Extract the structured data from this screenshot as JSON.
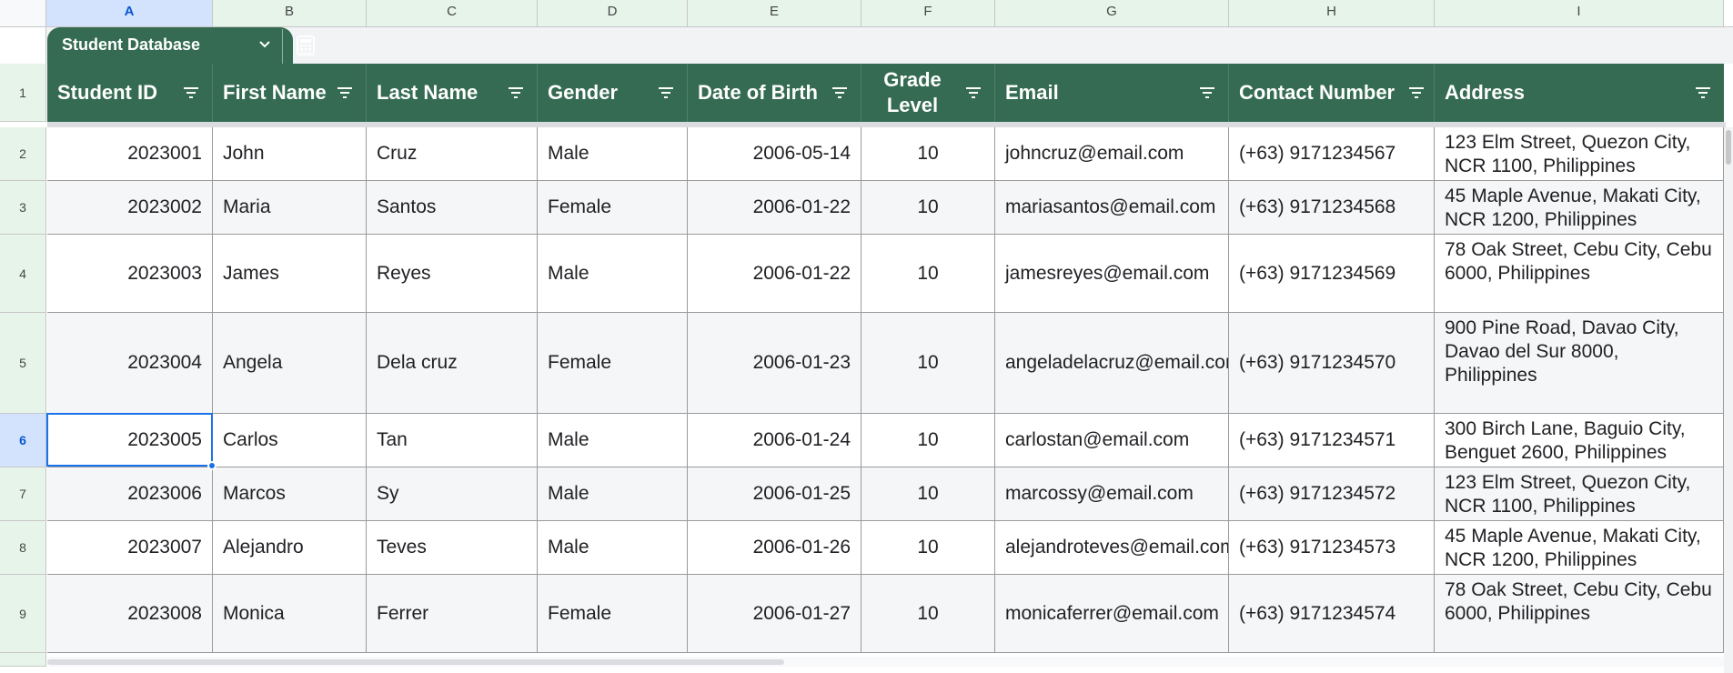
{
  "sheet": {
    "columns": [
      "A",
      "B",
      "C",
      "D",
      "E",
      "F",
      "G",
      "H",
      "I"
    ],
    "selected_column": "A",
    "selected_row": "6",
    "row_numbers": [
      "1",
      "2",
      "3",
      "4",
      "5",
      "6",
      "7",
      "8",
      "9"
    ]
  },
  "table": {
    "name": "Student Database",
    "headers": [
      "Student ID",
      "First Name",
      "Last Name",
      "Gender",
      "Date of Birth",
      "Grade Level",
      "Email",
      "Contact Number",
      "Address"
    ],
    "rows": [
      [
        "2023001",
        "John",
        "Cruz",
        "Male",
        "2006-05-14",
        "10",
        "johncruz@email.com",
        "(+63) 9171234567",
        "123 Elm Street, Quezon City, NCR 1100, Philippines"
      ],
      [
        "2023002",
        "Maria",
        "Santos",
        "Female",
        "2006-01-22",
        "10",
        "mariasantos@email.com",
        "(+63) 9171234568",
        "45 Maple Avenue, Makati City, NCR 1200, Philippines"
      ],
      [
        "2023003",
        "James",
        "Reyes",
        "Male",
        "2006-01-22",
        "10",
        "jamesreyes@email.com",
        "(+63) 9171234569",
        "78 Oak Street, Cebu City, Cebu 6000, Philippines"
      ],
      [
        "2023004",
        "Angela",
        "Dela cruz",
        "Female",
        "2006-01-23",
        "10",
        "angeladelacruz@email.com",
        "(+63) 9171234570",
        "900 Pine Road, Davao City, Davao del Sur 8000, Philippines"
      ],
      [
        "2023005",
        "Carlos",
        "Tan",
        "Male",
        "2006-01-24",
        "10",
        "carlostan@email.com",
        "(+63) 9171234571",
        "300 Birch Lane, Baguio City, Benguet 2600, Philippines"
      ],
      [
        "2023006",
        "Marcos",
        "Sy",
        "Male",
        "2006-01-25",
        "10",
        "marcossy@email.com",
        "(+63) 9171234572",
        "123 Elm Street, Quezon City, NCR 1100, Philippines"
      ],
      [
        "2023007",
        "Alejandro",
        "Teves",
        "Male",
        "2006-01-26",
        "10",
        "alejandroteves@email.com",
        "(+63) 9171234573",
        "45 Maple Avenue, Makati City, NCR 1200, Philippines"
      ],
      [
        "2023008",
        "Monica",
        "Ferrer",
        "Female",
        "2006-01-27",
        "10",
        "monicaferrer@email.com",
        "(+63) 9171234574",
        "78 Oak Street, Cebu City, Cebu 6000, Philippines"
      ]
    ]
  },
  "colors": {
    "header_green": "#346b52",
    "selection_blue": "#1a73e8"
  },
  "icons": [
    "chevron-down-icon",
    "calculator-icon",
    "filter-icon"
  ]
}
